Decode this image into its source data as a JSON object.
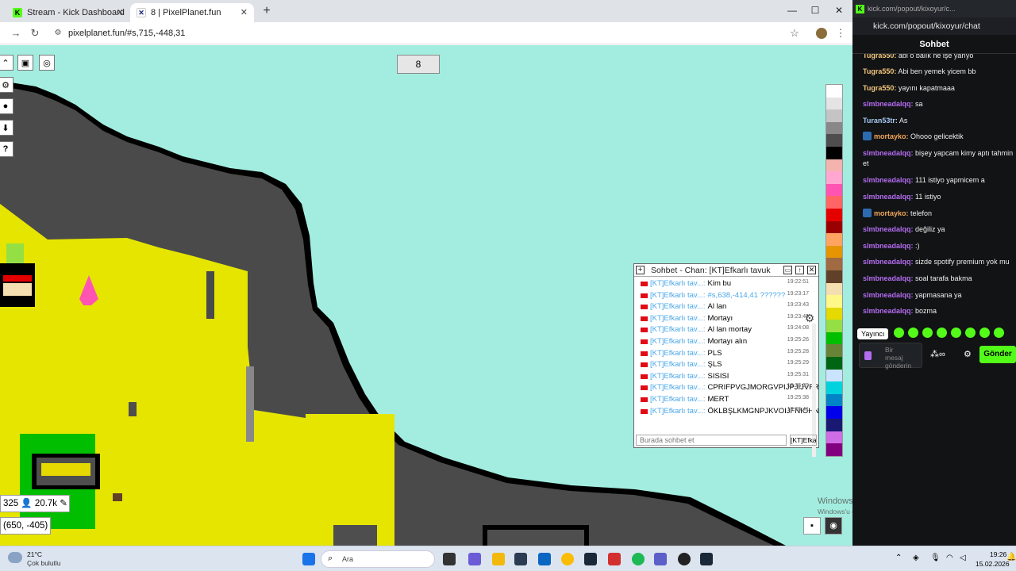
{
  "browser": {
    "tabs": [
      {
        "label": "Stream - Kick Dashboard",
        "favicon": "kick-icon",
        "active": false
      },
      {
        "label": "8 | PixelPlanet.fun",
        "favicon": "pixelplanet-icon",
        "active": true
      }
    ],
    "url": "pixelplanet.fun/#s,715,-448,31"
  },
  "pixelplanet": {
    "canvas_button": "8",
    "coordinates": "(650, -405)",
    "online_count": "325",
    "pixel_count": "20.7k",
    "palette": [
      "#ffffff",
      "#e4e4e4",
      "#c4c4c4",
      "#888888",
      "#4e4e4e",
      "#000000",
      "#f4b3ae",
      "#ffa7d1",
      "#ff54b2",
      "#ff6565",
      "#e50000",
      "#9a0000",
      "#fea460",
      "#e59500",
      "#a06a42",
      "#604028",
      "#f5dfb0",
      "#fff889",
      "#e5d900",
      "#94e044",
      "#02be01",
      "#688338",
      "#006513",
      "#cae3ff",
      "#00d3dd",
      "#0083c7",
      "#0000ea",
      "#191973",
      "#cf6ee4",
      "#820080"
    ],
    "chat": {
      "title": "Sohbet - Chan: [KT]Efkarlı tavuk",
      "input_placeholder": "Burada sohbet et",
      "name_button": "[KT]Efka",
      "messages": [
        {
          "user": "[KT]Efkarlı tav...:",
          "text": "Kim bu",
          "time": "19:22:51"
        },
        {
          "user": "[KT]Efkarlı tav...:",
          "text": "#s,638,-414,41 ??????",
          "time": "19:23:17"
        },
        {
          "user": "[KT]Efkarlı tav...:",
          "text": "Al lan",
          "time": "19:23:43"
        },
        {
          "user": "[KT]Efkarlı tav...:",
          "text": "Mortayı",
          "time": "19:23:45"
        },
        {
          "user": "[KT]Efkarlı tav...:",
          "text": "Al lan mortay",
          "time": "19:24:08"
        },
        {
          "user": "[KT]Efkarlı tav...:",
          "text": "Mortayı alın",
          "time": "19:25:26"
        },
        {
          "user": "[KT]Efkarlı tav...:",
          "text": "PLS",
          "time": "19:25:28"
        },
        {
          "user": "[KT]Efkarlı tav...:",
          "text": "ŞLS",
          "time": "19:25:29"
        },
        {
          "user": "[KT]Efkarlı tav...:",
          "text": "SISISI",
          "time": "19:25:31"
        },
        {
          "user": "[KT]Efkarlı tav...:",
          "text": "CPRIFPVGJMORGVPIJPJIJVFRIJNRGVJNJO",
          "time": "19:25:35"
        },
        {
          "user": "[KT]Efkarlı tav...:",
          "text": "MERT",
          "time": "19:25:38"
        },
        {
          "user": "[KT]Efkarlı tav...:",
          "text": "ÖKLBŞLKMGNPJKVOIJFNIOHNFCHIOJIOJN",
          "time": "19:25:41"
        }
      ]
    }
  },
  "kick": {
    "window_url": "kick.com/popout/kixoyur/c...",
    "url": "kick.com/popout/kixoyur/chat",
    "header": "Sohbet",
    "messages": [
      {
        "user": "Tugra550:",
        "text": "abi o balık ne işe yarıyo",
        "color": "#f2c57c"
      },
      {
        "user": "Tugra550:",
        "text": "Abi ben yemek yicem bb",
        "color": "#f2c57c"
      },
      {
        "user": "Tugra550:",
        "text": "yayını kapatmaaa",
        "color": "#f2c57c"
      },
      {
        "user": "slmbneadalqq:",
        "text": "sa",
        "color": "#b46cf0"
      },
      {
        "user": "Turan53tr:",
        "text": "As",
        "color": "#a6c8f0"
      },
      {
        "user": "mortayko:",
        "text": "Ohooo gelicektik",
        "color": "#f2a65a"
      },
      {
        "user": "slmbneadalqq:",
        "text": "bişey yapcam kimy aptı tahmin et",
        "color": "#b46cf0"
      },
      {
        "user": "slmbneadalqq:",
        "text": "111 istiyo yapmicem a",
        "color": "#b46cf0"
      },
      {
        "user": "slmbneadalqq:",
        "text": "11 istiyo",
        "color": "#b46cf0"
      },
      {
        "user": "mortayko:",
        "text": "telefon",
        "color": "#f2a65a"
      },
      {
        "user": "slmbneadalqq:",
        "text": "değiliz ya",
        "color": "#b46cf0"
      },
      {
        "user": "slmbneadalqq:",
        "text": ":)",
        "color": "#b46cf0"
      },
      {
        "user": "slmbneadalqq:",
        "text": "sizde spotify premium yok mu",
        "color": "#b46cf0"
      },
      {
        "user": "slmbneadalqq:",
        "text": "soal tarafa bakma",
        "color": "#b46cf0"
      },
      {
        "user": "slmbneadalqq:",
        "text": "yapmasana ya",
        "color": "#b46cf0"
      },
      {
        "user": "slmbneadalqq:",
        "text": "bozma",
        "color": "#b46cf0"
      }
    ],
    "tooltip": "Yayıncı",
    "input_placeholder": "Bir mesaj gönderin",
    "send_button": "Gönder"
  },
  "watermark": {
    "line1": "Windows'u Etkinleştir",
    "line2": "Windows'u etkinleştirmek için Ayarlar'a gidin."
  },
  "taskbar": {
    "weather_temp": "21°C",
    "weather_desc": "Çok bulutlu",
    "search": "Ara",
    "time": "19:26",
    "date": "15.02.2026"
  }
}
